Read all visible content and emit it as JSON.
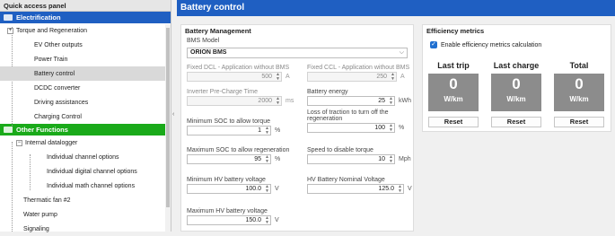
{
  "sidebar": {
    "header": "Quick access panel",
    "electrification": "Electrification",
    "elec_items": [
      "Torque and Regeneration",
      "EV Other outputs",
      "Power Train",
      "Battery control",
      "DCDC converter",
      "Driving assistances",
      "Charging Control"
    ],
    "other": "Other Functions",
    "datalogger": "Internal datalogger",
    "datalogger_items": [
      "Individual channel options",
      "Individual digital channel options",
      "Individual math channel options"
    ],
    "other_items": [
      "Thermatic fan #2",
      "Water pump",
      "Signaling"
    ]
  },
  "main": {
    "title": "Battery control",
    "bm": {
      "section": "Battery Management",
      "bms_model_label": "BMS Model",
      "bms_model_value": "ORION BMS",
      "fixed_dcl_label": "Fixed DCL - Application without BMS",
      "fixed_dcl_value": "500",
      "fixed_dcl_unit": "A",
      "fixed_ccl_label": "Fixed CCL - Application without BMS",
      "fixed_ccl_value": "250",
      "fixed_ccl_unit": "A",
      "precharge_label": "Inverter Pre-Charge Time",
      "precharge_value": "2000",
      "precharge_unit": "ms",
      "energy_label": "Battery energy",
      "energy_value": "25",
      "energy_unit": "kWh",
      "minsoc_label": "Minimum SOC to allow torque",
      "minsoc_value": "1",
      "minsoc_unit": "%",
      "loss_label_1": "Loss of traction to turn off the",
      "loss_label_2": "regeneration",
      "loss_value": "100",
      "loss_unit": "%",
      "maxsoc_label": "Maximum SOC to allow regeneration",
      "maxsoc_value": "95",
      "maxsoc_unit": "%",
      "speed_label": "Speed to disable torque",
      "speed_value": "10",
      "speed_unit": "Mph",
      "minhv_label": "Minimum HV battery voltage",
      "minhv_value": "100.0",
      "minhv_unit": "V",
      "nomhv_label": "HV Battery Nominal Voltage",
      "nomhv_value": "125.0",
      "nomhv_unit": "V",
      "maxhv_label": "Maximum HV battery voltage",
      "maxhv_value": "150.0",
      "maxhv_unit": "V"
    },
    "eff": {
      "section": "Efficiency metrics",
      "enable_label": "Enable efficiency metrics calculation",
      "cols": [
        {
          "title": "Last trip",
          "value": "0",
          "unit": "W/km",
          "reset": "Reset"
        },
        {
          "title": "Last charge",
          "value": "0",
          "unit": "W/km",
          "reset": "Reset"
        },
        {
          "title": "Total",
          "value": "0",
          "unit": "W/km",
          "reset": "Reset"
        }
      ]
    }
  }
}
